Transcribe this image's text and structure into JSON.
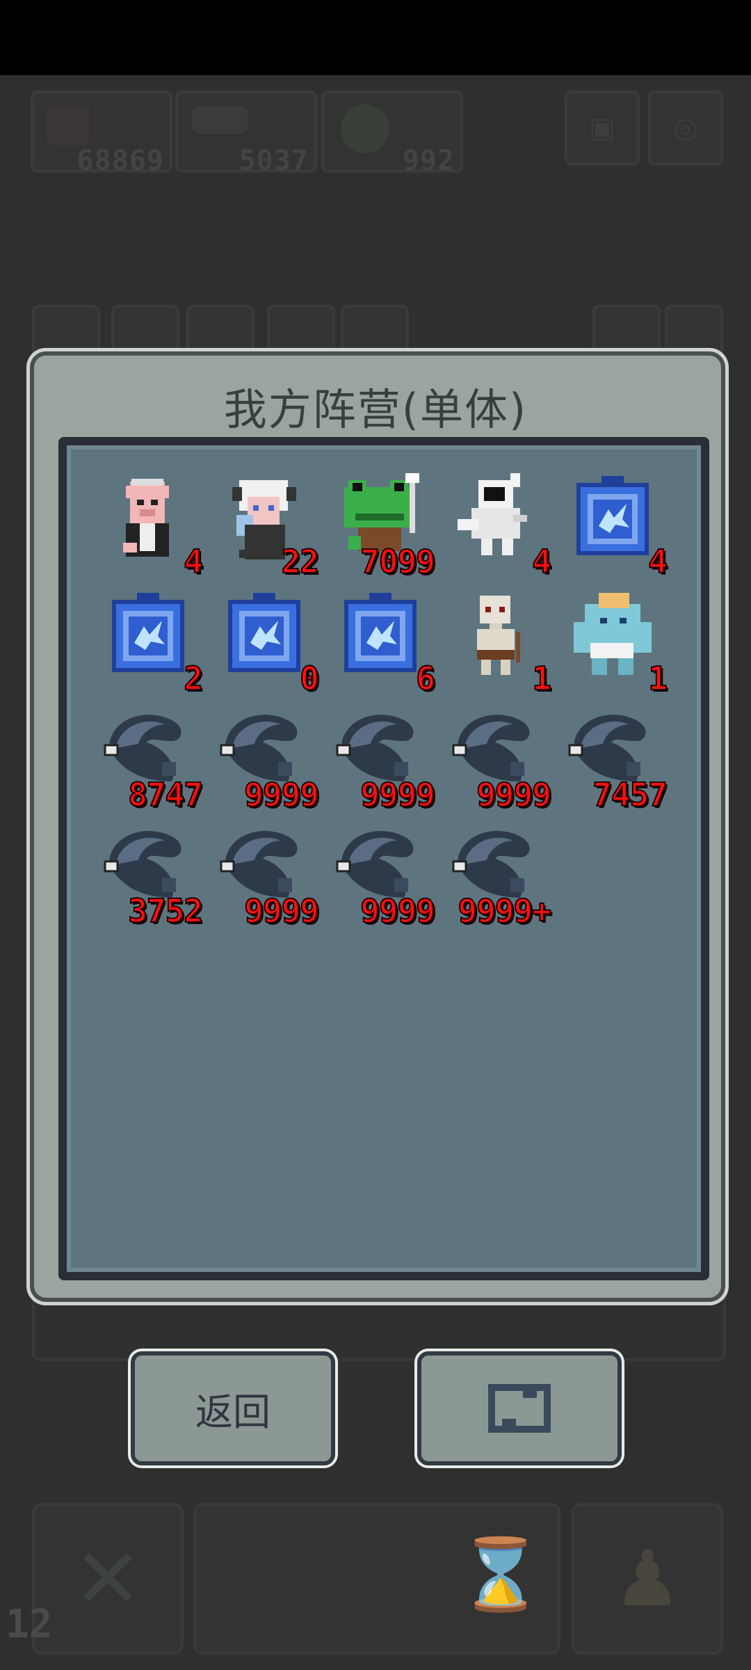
{
  "hud": {
    "resources": [
      {
        "icon": "meat-icon",
        "count": "68869"
      },
      {
        "icon": "bones-icon",
        "count": "5037"
      },
      {
        "icon": "clover-icon",
        "count": "992"
      }
    ],
    "level": "12"
  },
  "modal": {
    "title": "我方阵营(单体)",
    "units": [
      {
        "type": "pig-butler",
        "count": "4"
      },
      {
        "type": "white-haired-demon-girl",
        "count": "22"
      },
      {
        "type": "frog-warrior",
        "count": "7099"
      },
      {
        "type": "ghost-rogue",
        "count": "4"
      },
      {
        "type": "crystal-portal",
        "count": "4"
      },
      {
        "type": "crystal-portal",
        "count": "2"
      },
      {
        "type": "crystal-portal",
        "count": "0"
      },
      {
        "type": "crystal-portal",
        "count": "6"
      },
      {
        "type": "skeleton-warrior",
        "count": "1"
      },
      {
        "type": "ice-golem",
        "count": "1"
      },
      {
        "type": "dark-fish",
        "count": "8747"
      },
      {
        "type": "dark-fish",
        "count": "9999"
      },
      {
        "type": "dark-fish",
        "count": "9999"
      },
      {
        "type": "dark-fish",
        "count": "9999"
      },
      {
        "type": "dark-fish",
        "count": "7457"
      },
      {
        "type": "dark-fish",
        "count": "3752"
      },
      {
        "type": "dark-fish",
        "count": "9999"
      },
      {
        "type": "dark-fish",
        "count": "9999"
      },
      {
        "type": "dark-fish",
        "count": "9999+"
      }
    ]
  },
  "buttons": {
    "back_label": "返回",
    "refresh_icon": "refresh-icon"
  },
  "colors": {
    "panel": "#9aa5a0",
    "inner": "#5e7580",
    "count_red": "#ff1010"
  }
}
